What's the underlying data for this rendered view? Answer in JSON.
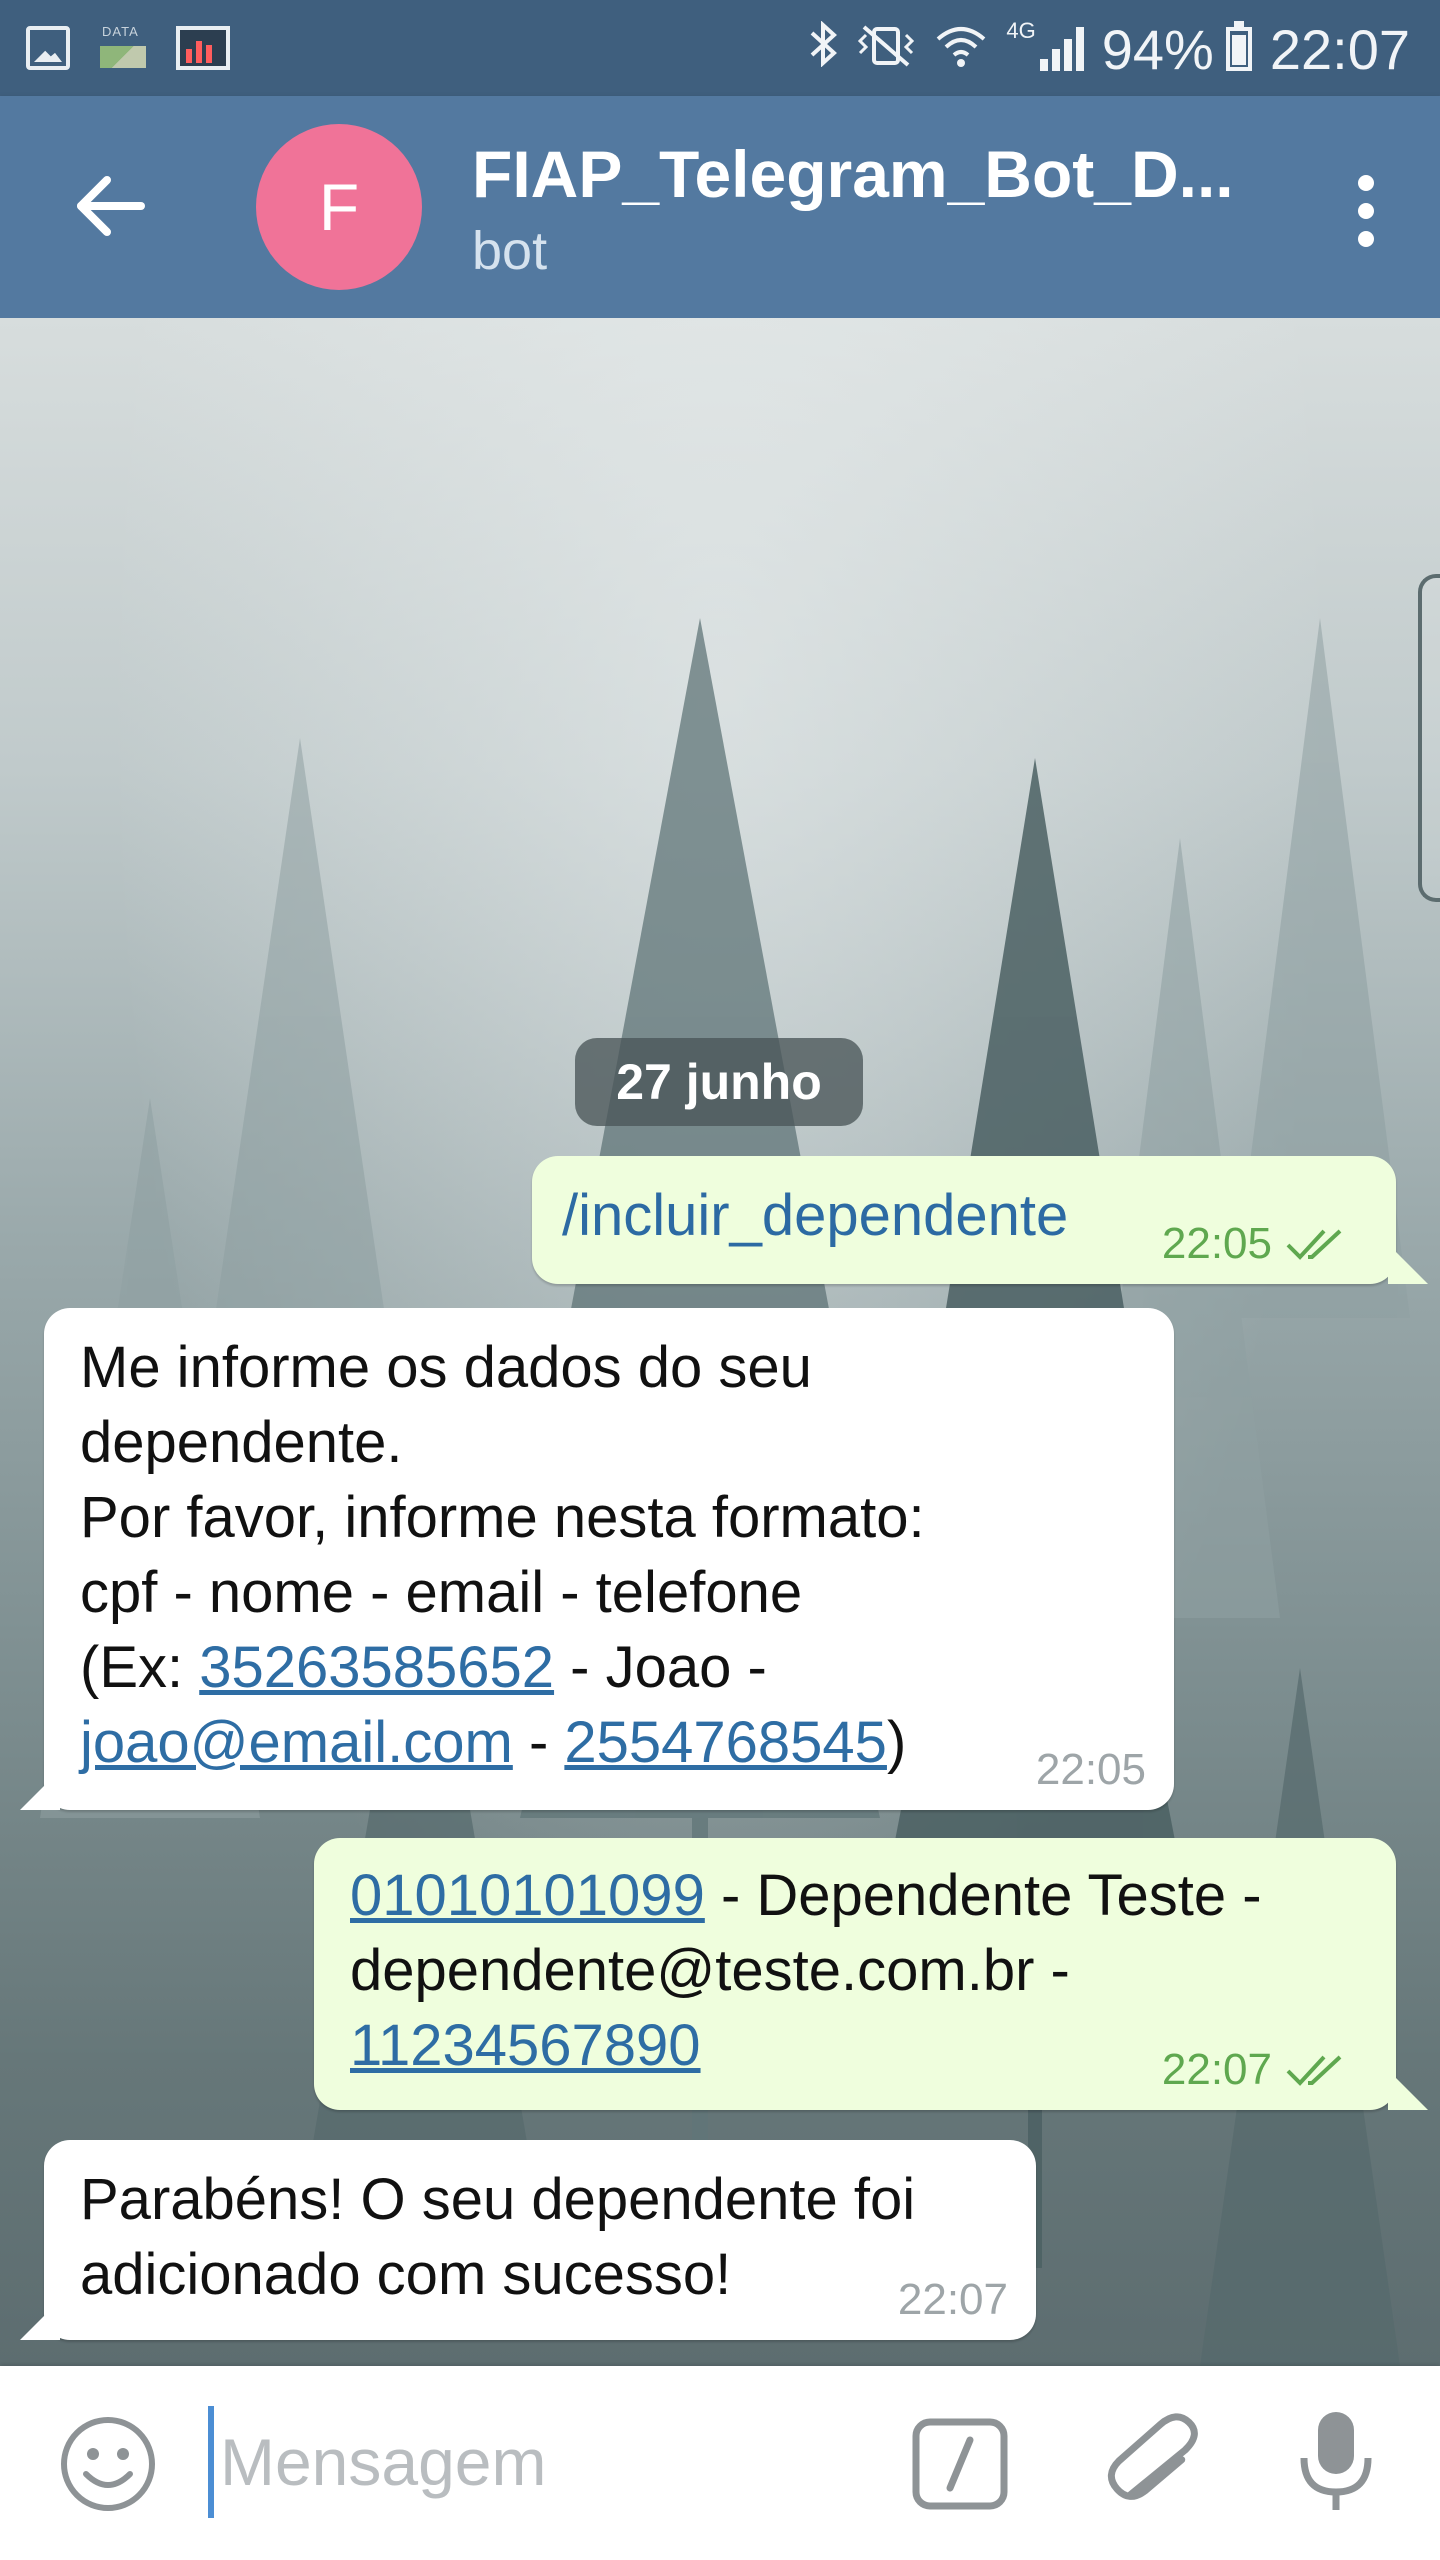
{
  "status_bar": {
    "battery": "94%",
    "time": "22:07",
    "network": "4G",
    "data_label": "DATA",
    "icons": [
      "gallery-icon",
      "data-icon",
      "monitor-icon",
      "bluetooth-icon",
      "vibrate-icon",
      "wifi-icon",
      "signal-icon",
      "battery-icon"
    ]
  },
  "header": {
    "avatar_letter": "F",
    "avatar_color": "#f07398",
    "title": "FIAP_Telegram_Bot_D...",
    "subtitle": "bot"
  },
  "chat": {
    "date": "27 junho",
    "messages": [
      {
        "direction": "out",
        "command": "/incluir_dependente",
        "time": "22:05",
        "status": "read"
      },
      {
        "direction": "in",
        "line1": "Me informe os dados do seu",
        "line2": "dependente.",
        "line3": "Por favor, informe nesta formato:",
        "line4": "cpf - nome - email - telefone",
        "ex_prefix": "(Ex: ",
        "ex_cpf": "35263585652",
        "ex_name": " - Joao -",
        "ex_email": "joao@email.com",
        "ex_sep": " - ",
        "ex_phone": "2554768545",
        "ex_suffix": ")",
        "time": "22:05"
      },
      {
        "direction": "out",
        "cpf": "01010101099",
        "name_part": " - Dependente Teste -",
        "email_part": "dependente@teste.com.br -",
        "phone": "11234567890",
        "time": "22:07",
        "status": "read"
      },
      {
        "direction": "in",
        "line1": "Parabéns! O seu dependente foi",
        "line2": "adicionado com sucesso!",
        "time": "22:07"
      }
    ]
  },
  "input": {
    "placeholder": "Mensagem"
  },
  "colors": {
    "status_bar": "#3f5f7e",
    "header": "#5379a0",
    "out_bubble": "#effedd",
    "in_bubble": "#ffffff",
    "link": "#2e6da4",
    "read_check": "#5fa84f"
  }
}
